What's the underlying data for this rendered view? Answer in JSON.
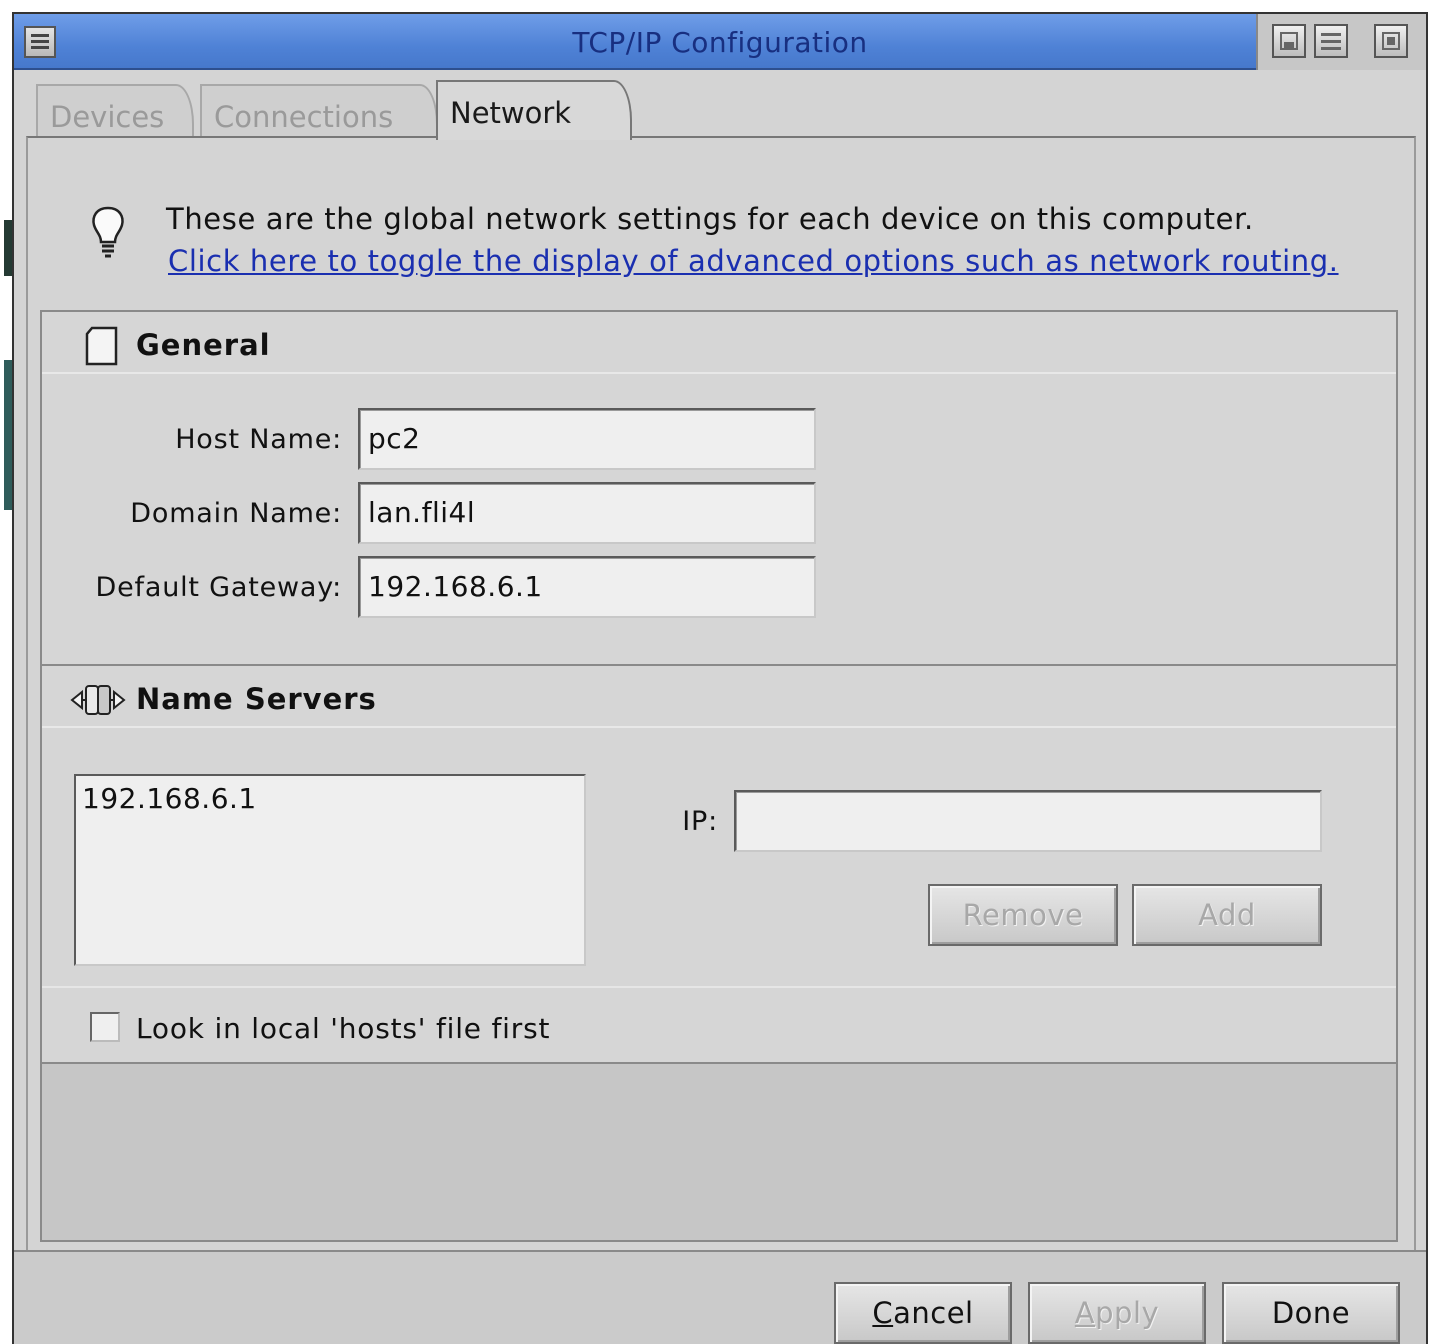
{
  "window": {
    "title": "TCP/IP Configuration"
  },
  "tabs": [
    {
      "label": "Devices",
      "active": false
    },
    {
      "label": "Connections",
      "active": false
    },
    {
      "label": "Network",
      "active": true
    }
  ],
  "info": {
    "icon": "lightbulb-icon",
    "text": "These are the global network settings for each device on this computer.",
    "link": "Click here to toggle the display of advanced options such as network routing."
  },
  "general": {
    "title": "General",
    "icon": "document-icon",
    "host_name_label": "Host Name:",
    "host_name_value": "pc2",
    "domain_name_label": "Domain Name:",
    "domain_name_value": "lan.fli4l",
    "gateway_label": "Default Gateway:",
    "gateway_value": "192.168.6.1"
  },
  "name_servers": {
    "title": "Name Servers",
    "icon": "network-arrows-icon",
    "items": [
      "192.168.6.1"
    ],
    "ip_label": "IP:",
    "ip_value": "",
    "remove_label": "Remove",
    "add_label": "Add"
  },
  "hosts_checkbox": {
    "label": "Look in local 'hosts' file first",
    "checked": false
  },
  "footer": {
    "cancel_first": "C",
    "cancel_rest": "ancel",
    "apply_first": "A",
    "apply_rest": "pply",
    "done_label": "Done"
  },
  "colors": {
    "titlebar": "#5a8ad9",
    "title_text": "#182f80",
    "link": "#1a2fb0",
    "window_bg": "#d4d4d4"
  }
}
